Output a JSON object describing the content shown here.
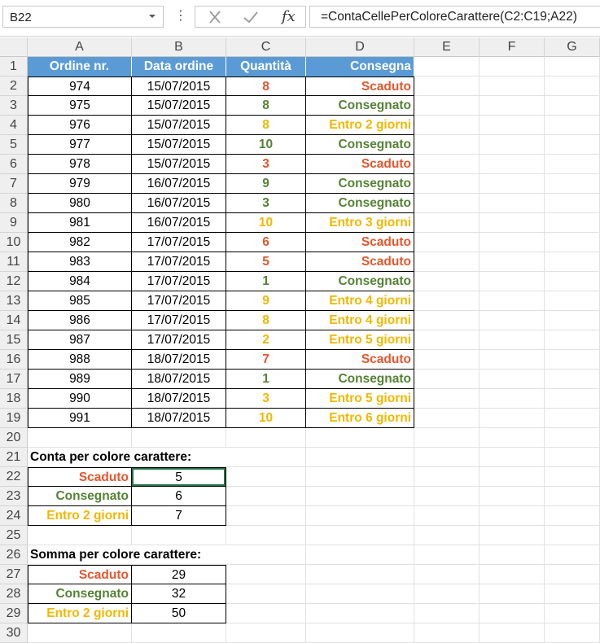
{
  "formula_bar": {
    "name_box": "B22",
    "fx_label": "fx",
    "formula": "=ContaCellePerColoreCarattere(C2:C19;A22)"
  },
  "colors": {
    "red": "#e4572e",
    "green": "#548235",
    "yellow": "#f1b800",
    "header_blue": "#5b9bd5"
  },
  "columns": [
    "A",
    "B",
    "C",
    "D",
    "E",
    "F",
    "G"
  ],
  "rows": [
    "1",
    "2",
    "3",
    "4",
    "5",
    "6",
    "7",
    "8",
    "9",
    "10",
    "11",
    "12",
    "13",
    "14",
    "15",
    "16",
    "17",
    "18",
    "19",
    "20",
    "21",
    "22",
    "23",
    "24",
    "25",
    "26",
    "27",
    "28",
    "29",
    "30"
  ],
  "table": {
    "headers": [
      "Ordine nr.",
      "Data ordine",
      "Quantità",
      "Consegna"
    ],
    "rows": [
      {
        "order": "974",
        "date": "15/07/2015",
        "qty": "8",
        "delivery": "Scaduto",
        "color": "red"
      },
      {
        "order": "975",
        "date": "15/07/2015",
        "qty": "8",
        "delivery": "Consegnato",
        "color": "green"
      },
      {
        "order": "976",
        "date": "15/07/2015",
        "qty": "8",
        "delivery": "Entro 2 giorni",
        "color": "yellow"
      },
      {
        "order": "977",
        "date": "15/07/2015",
        "qty": "10",
        "delivery": "Consegnato",
        "color": "green"
      },
      {
        "order": "978",
        "date": "15/07/2015",
        "qty": "3",
        "delivery": "Scaduto",
        "color": "red"
      },
      {
        "order": "979",
        "date": "16/07/2015",
        "qty": "9",
        "delivery": "Consegnato",
        "color": "green"
      },
      {
        "order": "980",
        "date": "16/07/2015",
        "qty": "3",
        "delivery": "Consegnato",
        "color": "green"
      },
      {
        "order": "981",
        "date": "16/07/2015",
        "qty": "10",
        "delivery": "Entro 3 giorni",
        "color": "yellow"
      },
      {
        "order": "982",
        "date": "17/07/2015",
        "qty": "6",
        "delivery": "Scaduto",
        "color": "red"
      },
      {
        "order": "983",
        "date": "17/07/2015",
        "qty": "5",
        "delivery": "Scaduto",
        "color": "red"
      },
      {
        "order": "984",
        "date": "17/07/2015",
        "qty": "1",
        "delivery": "Consegnato",
        "color": "green"
      },
      {
        "order": "985",
        "date": "17/07/2015",
        "qty": "9",
        "delivery": "Entro 4 giorni",
        "color": "yellow"
      },
      {
        "order": "986",
        "date": "17/07/2015",
        "qty": "8",
        "delivery": "Entro 4 giorni",
        "color": "yellow"
      },
      {
        "order": "987",
        "date": "17/07/2015",
        "qty": "2",
        "delivery": "Entro 5 giorni",
        "color": "yellow"
      },
      {
        "order": "988",
        "date": "18/07/2015",
        "qty": "7",
        "delivery": "Scaduto",
        "color": "red"
      },
      {
        "order": "989",
        "date": "18/07/2015",
        "qty": "1",
        "delivery": "Consegnato",
        "color": "green"
      },
      {
        "order": "990",
        "date": "18/07/2015",
        "qty": "3",
        "delivery": "Entro 5 giorni",
        "color": "yellow"
      },
      {
        "order": "991",
        "date": "18/07/2015",
        "qty": "10",
        "delivery": "Entro 6 giorni",
        "color": "yellow"
      }
    ]
  },
  "count_section": {
    "title": "Conta per colore carattere:",
    "rows": [
      {
        "label": "Scaduto",
        "value": "5",
        "color": "red"
      },
      {
        "label": "Consegnato",
        "value": "6",
        "color": "green"
      },
      {
        "label": "Entro 2 giorni",
        "value": "7",
        "color": "yellow"
      }
    ]
  },
  "sum_section": {
    "title": "Somma per colore carattere:",
    "rows": [
      {
        "label": "Scaduto",
        "value": "29",
        "color": "red"
      },
      {
        "label": "Consegnato",
        "value": "32",
        "color": "green"
      },
      {
        "label": "Entro 2 giorni",
        "value": "50",
        "color": "yellow"
      }
    ]
  }
}
